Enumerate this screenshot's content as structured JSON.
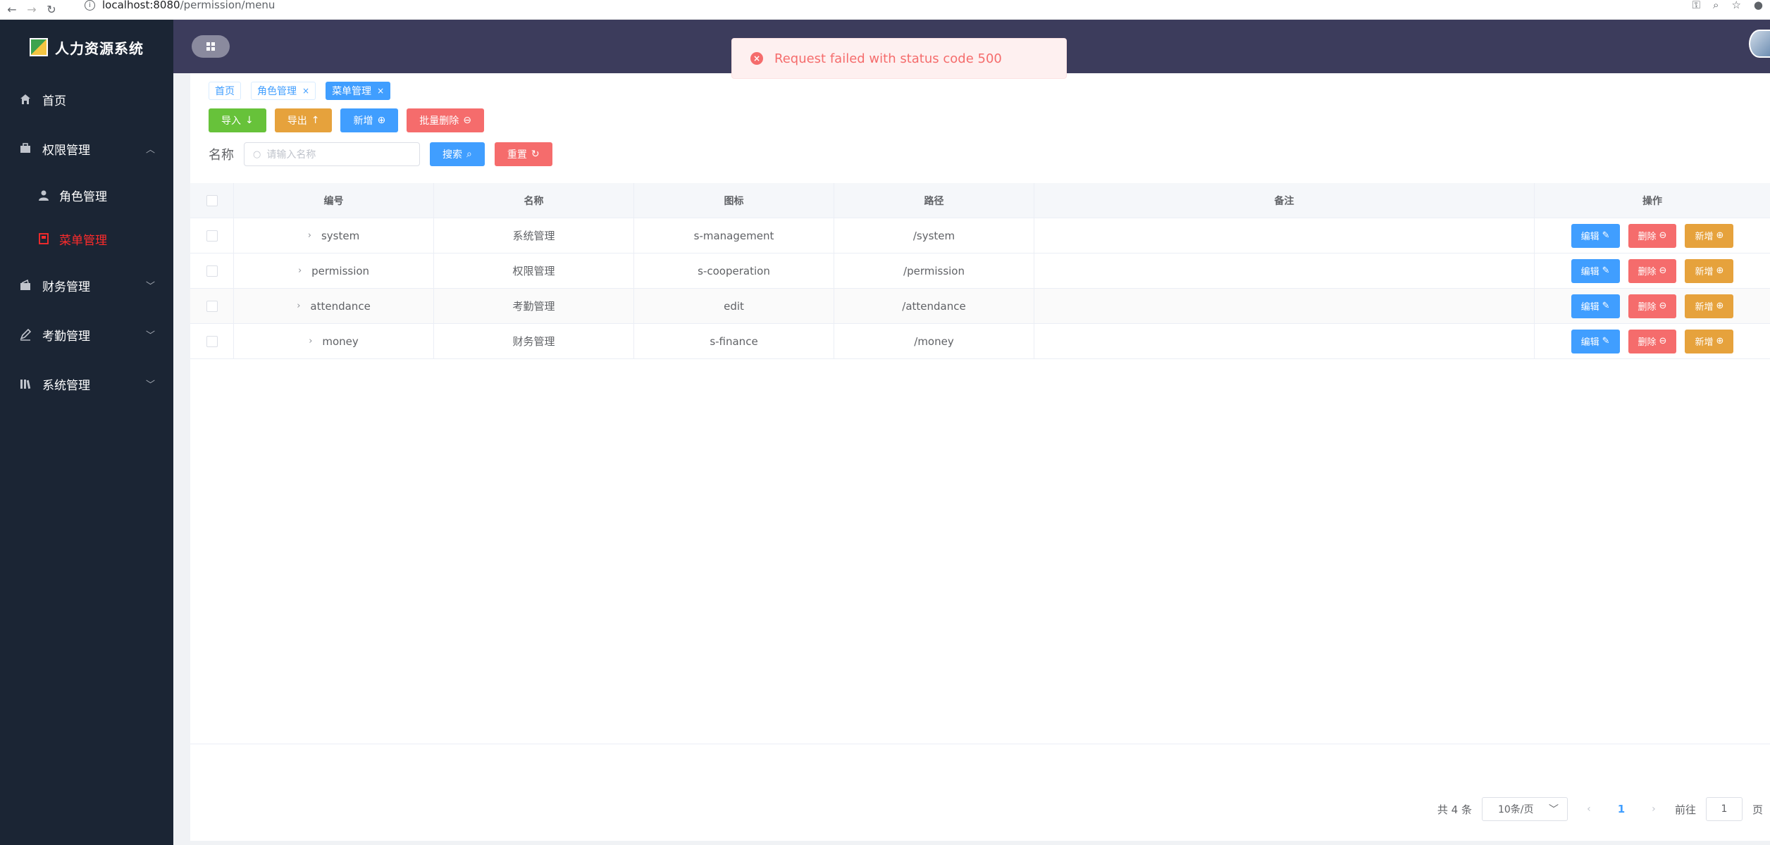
{
  "browser": {
    "url_host": "localhost:8080",
    "url_path": "/permission/menu"
  },
  "sidebar": {
    "app_title": "人力资源系统",
    "items": [
      {
        "label": "首页",
        "icon": "home-icon"
      },
      {
        "label": "权限管理",
        "icon": "briefcase-icon",
        "expanded": true,
        "children": [
          {
            "label": "角色管理",
            "icon": "user-icon"
          },
          {
            "label": "菜单管理",
            "icon": "menu-icon",
            "active": true
          }
        ]
      },
      {
        "label": "财务管理",
        "icon": "wallet-icon"
      },
      {
        "label": "考勤管理",
        "icon": "pen-icon"
      },
      {
        "label": "系统管理",
        "icon": "library-icon"
      }
    ]
  },
  "toast": {
    "message": "Request failed with status code 500",
    "color": "#f56c6c"
  },
  "tags": [
    {
      "label": "首页"
    },
    {
      "label": "角色管理"
    },
    {
      "label": "菜单管理",
      "active": true
    }
  ],
  "toolbar": {
    "import_label": "导入",
    "export_label": "导出",
    "add_label": "新增",
    "batch_delete_label": "批量删除"
  },
  "search": {
    "label": "名称",
    "placeholder": "请输入名称",
    "search_label": "搜索",
    "reset_label": "重置"
  },
  "table": {
    "headers": {
      "id": "编号",
      "name": "名称",
      "icon": "图标",
      "path": "路径",
      "remark": "备注",
      "ops": "操作"
    },
    "rows": [
      {
        "id": "system",
        "name": "系统管理",
        "icon": "s-management",
        "path": "/system",
        "remark": ""
      },
      {
        "id": "permission",
        "name": "权限管理",
        "icon": "s-cooperation",
        "path": "/permission",
        "remark": ""
      },
      {
        "id": "attendance",
        "name": "考勤管理",
        "icon": "edit",
        "path": "/attendance",
        "remark": ""
      },
      {
        "id": "money",
        "name": "财务管理",
        "icon": "s-finance",
        "path": "/money",
        "remark": ""
      }
    ],
    "op_labels": {
      "edit": "编辑",
      "delete": "删除",
      "add": "新增"
    }
  },
  "pagination": {
    "total_text": "共 4 条",
    "page_size": "10条/页",
    "current_page": "1",
    "goto_prefix": "前往",
    "goto_value": "1",
    "goto_suffix": "页"
  },
  "colors": {
    "sidebar_bg": "#1b2534",
    "header_bg": "#3c3c5c",
    "primary": "#409eff",
    "success": "#67c23a",
    "warning": "#e6a23c",
    "danger": "#f56c6c",
    "active_menu": "#ff2b2b"
  }
}
